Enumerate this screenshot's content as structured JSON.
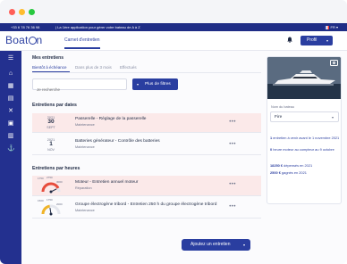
{
  "topbar": {
    "phone": "+33 6 78 76 36 98",
    "tagline": "| La 1ère application pour gérer votre bateau de A à Z",
    "lang": "FR"
  },
  "header": {
    "logo": "BoatOn",
    "nav_tab": "Carnet d'entretien",
    "profile_label": "Profil"
  },
  "main": {
    "title": "Mes entretiens",
    "filter_tabs": [
      "Bientôt à échéance",
      "Dans plus de 3 mois",
      "Effectués"
    ],
    "search_placeholder": "Je recherche",
    "more_filters_label": "Plus de filtres",
    "section_dates_title": "Entretiens par dates",
    "date_rows": [
      {
        "year": "2021",
        "day": "30",
        "month": "SEPT",
        "title": "Passerelle - Réglage de la passerelle",
        "subtitle": "Maintenance",
        "more": "•••"
      },
      {
        "year": "2021",
        "day": "1",
        "month": "NOV",
        "title": "Batteries générateur - Contrôle des batteries",
        "subtitle": "Maintenance",
        "more": "•••"
      }
    ],
    "section_hours_title": "Entretiens par heures",
    "hour_rows": [
      {
        "title": "Moteur - Entretien annuel moteur",
        "subtitle": "Réparation",
        "more": "•••",
        "level": 0.85,
        "gauge_labels": [
          "1750",
          "2750",
          "3000"
        ]
      },
      {
        "title": "Groupe électrogène tribord - Entretien 250 h du groupe électrogène tribord",
        "subtitle": "Maintenance",
        "more": "•••",
        "level": 0.45,
        "gauge_labels": [
          "1500",
          "1750",
          "2000"
        ]
      }
    ],
    "add_button_label": "Ajoutez un entretien"
  },
  "card": {
    "boat_label": "Nom du bateau",
    "boat_value": "Fire",
    "info": [
      {
        "strong": "1",
        "text": " entretien à venir avant le 1 novembre 2021"
      },
      {
        "strong": "0",
        "text": " heure moteur au compteur au 9 octobre"
      },
      {
        "strong": "18250 €",
        "text": " dépensés en 2021"
      },
      {
        "strong": "2500 €",
        "text": " gagnés en 2021"
      }
    ]
  },
  "colors": {
    "brand": "#2a3ea0",
    "sidebar": "#23308f",
    "highlight": "#fbe9e9"
  },
  "icons": [
    "menu-icon",
    "home-icon",
    "calendar-icon",
    "file-icon",
    "tools-icon",
    "inventory-icon",
    "wallet-icon",
    "anchor-icon",
    "bell-icon",
    "camera-icon"
  ]
}
